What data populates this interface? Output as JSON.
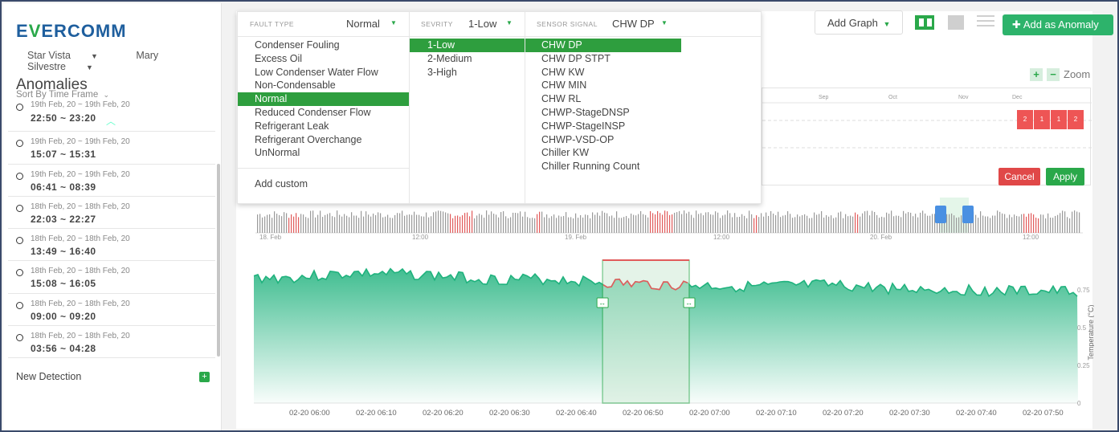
{
  "app": {
    "logo_prefix": "E",
    "logo_v": "V",
    "logo_suffix": "ERCOMM"
  },
  "userbar": {
    "site": "Star Vista",
    "user": "Mary Silvestre"
  },
  "sidebar": {
    "title": "Anomalies",
    "sort_label": "Sort By Time Frame",
    "items": [
      {
        "range": "19th Feb, 20 ~ 19th Feb, 20",
        "time": "22:50 ~ 23:20"
      },
      {
        "range": "19th Feb, 20 ~ 19th Feb, 20",
        "time": "15:07 ~ 15:31"
      },
      {
        "range": "19th Feb, 20 ~ 19th Feb, 20",
        "time": "06:41 ~ 08:39"
      },
      {
        "range": "18th Feb, 20 ~ 18th Feb, 20",
        "time": "22:03 ~ 22:27"
      },
      {
        "range": "18th Feb, 20 ~ 18th Feb, 20",
        "time": "13:49 ~ 16:40"
      },
      {
        "range": "18th Feb, 20 ~ 18th Feb, 20",
        "time": "15:08 ~ 16:05"
      },
      {
        "range": "18th Feb, 20 ~ 18th Feb, 20",
        "time": "09:00 ~ 09:20"
      },
      {
        "range": "18th Feb, 20 ~ 18th Feb, 20",
        "time": "03:56 ~ 04:28"
      }
    ],
    "new_detection": "New Detection"
  },
  "toolbar": {
    "add_graph": "Add Graph",
    "add_anomaly": "Add as Anomaly",
    "zoom_label": "Zoom"
  },
  "dropdown": {
    "fault_type_label": "FAULT TYPE",
    "fault_type_value": "Normal",
    "severity_label": "SEVRITY",
    "severity_value": "1-Low",
    "sensor_label": "SENSOR SIGNAL",
    "sensor_value": "CHW DP",
    "fault_types": [
      "Condenser Fouling",
      "Excess Oil",
      "Low Condenser Water Flow",
      "Non-Condensable",
      "Normal",
      "Reduced Condenser Flow",
      "Refrigerant Leak",
      "Refrigerant Overchange",
      "UnNormal"
    ],
    "add_custom": "Add custom",
    "severities": [
      "1-Low",
      "2-Medium",
      "3-High"
    ],
    "sensors": [
      "CHW DP",
      "CHW DP STPT",
      "CHW KW",
      "CHW MIN",
      "CHW RL",
      "CHWP-StageDNSP",
      "CHWP-StageINSP",
      "CHWP-VSD-OP",
      "Chiller KW",
      "Chiller Running Count"
    ]
  },
  "month_grid": {
    "months": [
      "Sep",
      "Oct",
      "Nov",
      "Dec"
    ],
    "cells": [
      "2",
      "1",
      "1",
      "2"
    ],
    "cancel": "Cancel",
    "apply": "Apply"
  },
  "navigator": {
    "labels": [
      "18. Feb",
      "12:00",
      "19. Feb",
      "12:00",
      "20. Feb",
      "12:00"
    ]
  },
  "chart_data": {
    "type": "area",
    "title": "",
    "xlabel": "",
    "ylabel": "Temperature (°C)",
    "x": [
      "02-20 06:00",
      "02-20 06:10",
      "02-20 06:20",
      "02-20 06:30",
      "02-20 06:40",
      "02-20 06:50",
      "02-20 07:00",
      "02-20 07:10",
      "02-20 07:20",
      "02-20 07:30",
      "02-20 07:40",
      "02-20 07:50"
    ],
    "y_ticks": [
      "0.75",
      "0.5",
      "0.25",
      "0"
    ],
    "ylim": [
      0,
      1
    ],
    "series": [
      {
        "values": [
          0.83,
          0.86,
          0.85,
          0.82,
          0.82,
          0.79,
          0.78,
          0.77,
          0.78,
          0.76,
          0.75,
          0.74
        ]
      }
    ],
    "highlight": {
      "from": "02-20 06:47",
      "to": "02-20 07:00",
      "color": "#e15b5b"
    },
    "colors": {
      "line": "#1fb27d",
      "fill": "#1fb27d",
      "anomaly": "#e15b5b"
    }
  }
}
